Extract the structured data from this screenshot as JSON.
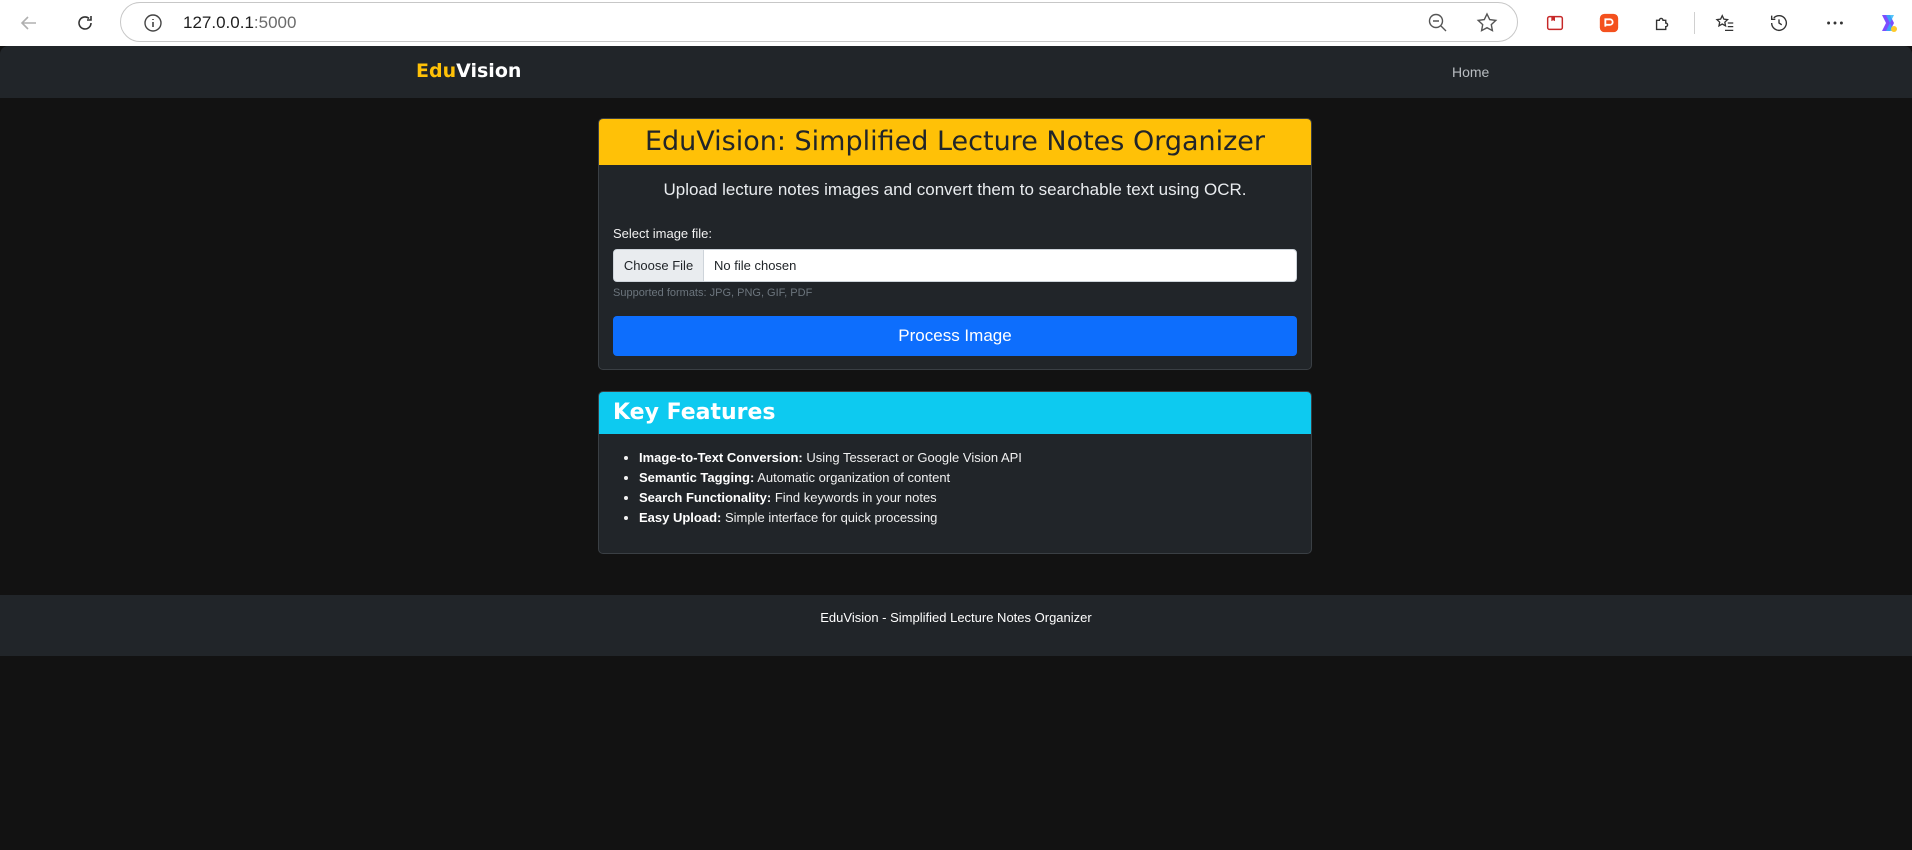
{
  "browser": {
    "url_host": "127.0.0.1",
    "url_port": ":5000"
  },
  "nav": {
    "brand_part1": "Edu",
    "brand_part2": "Vision",
    "home_link": "Home"
  },
  "upload_card": {
    "title": "EduVision: Simplified Lecture Notes Organizer",
    "subtitle": "Upload lecture notes images and convert them to searchable text using OCR.",
    "file_label": "Select image file:",
    "choose_button": "Choose File",
    "file_status": "No file chosen",
    "help_text": "Supported formats: JPG, PNG, GIF, PDF",
    "process_button": "Process Image"
  },
  "features_card": {
    "title": "Key Features",
    "items": [
      {
        "label": "Image-to-Text Conversion:",
        "text": " Using Tesseract or Google Vision API"
      },
      {
        "label": "Semantic Tagging:",
        "text": " Automatic organization of content"
      },
      {
        "label": "Search Functionality:",
        "text": " Find keywords in your notes"
      },
      {
        "label": "Easy Upload:",
        "text": " Simple interface for quick processing"
      }
    ]
  },
  "footer": {
    "text": "EduVision - Simplified Lecture Notes Organizer"
  },
  "colors": {
    "brand_accent": "#ffc107",
    "info": "#0dcaf0",
    "primary": "#0d6efd",
    "surface": "#212529",
    "background": "#121212"
  }
}
